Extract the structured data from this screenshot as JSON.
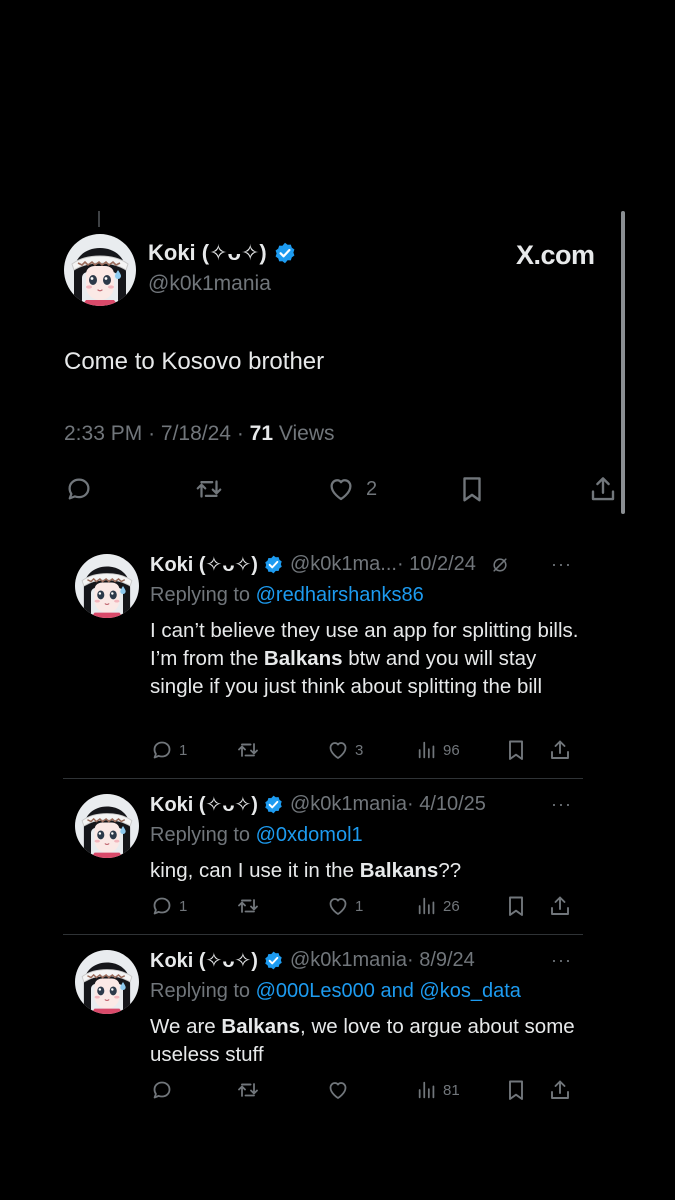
{
  "colors": {
    "background": "#000000",
    "text": "#e7e9ea",
    "muted": "#71767b",
    "link": "#1d9bf0",
    "verified": "#1d9bf0",
    "divider": "#2f3336"
  },
  "main_tweet": {
    "author": {
      "name": "Koki (✧ᴗ✧)",
      "handle": "@k0k1mania",
      "verified": true
    },
    "site_label": "X.com",
    "text": "Come to Kosovo brother",
    "time": "2:33 PM",
    "date": "7/18/24",
    "views_count": "71",
    "views_label": "Views",
    "sep": "·",
    "actions": {
      "reply_icon": "comment-icon",
      "retweet_icon": "retweet-icon",
      "like_icon": "heart-icon",
      "like_count": "2",
      "bookmark_icon": "bookmark-icon",
      "share_icon": "share-icon"
    }
  },
  "replies": [
    {
      "name": "Koki (✧ᴗ✧)",
      "handle": "@k0k1ma...",
      "date": "· 10/2/24",
      "replying_prefix": "Replying to",
      "replying_to": "@redhairshanks86",
      "text_parts": [
        "I can’t believe they use an app for splitting bills. I’m from the ",
        "Balkans",
        " btw and you will stay single if you just think about splitting the bill"
      ],
      "reply_count": "1",
      "retweet_count": "",
      "like_count": "3",
      "views_count": "96",
      "more": "···"
    },
    {
      "name": "Koki (✧ᴗ✧)",
      "handle": "@k0k1mania",
      "date": "· 4/10/25",
      "replying_prefix": "Replying to",
      "replying_to": "@0xdomol1",
      "text_parts": [
        "king, can I use it in the ",
        "Balkans",
        "??"
      ],
      "reply_count": "1",
      "retweet_count": "",
      "like_count": "1",
      "views_count": "26",
      "more": "···"
    },
    {
      "name": "Koki (✧ᴗ✧)",
      "handle": "@k0k1mania",
      "date": "· 8/9/24",
      "replying_prefix": "Replying to",
      "replying_to": "@000Les000 and @kos_data",
      "text_parts": [
        "We are ",
        "Balkans",
        ", we love to argue about some useless stuff"
      ],
      "reply_count": "",
      "retweet_count": "",
      "like_count": "",
      "views_count": "81",
      "more": "···"
    }
  ]
}
